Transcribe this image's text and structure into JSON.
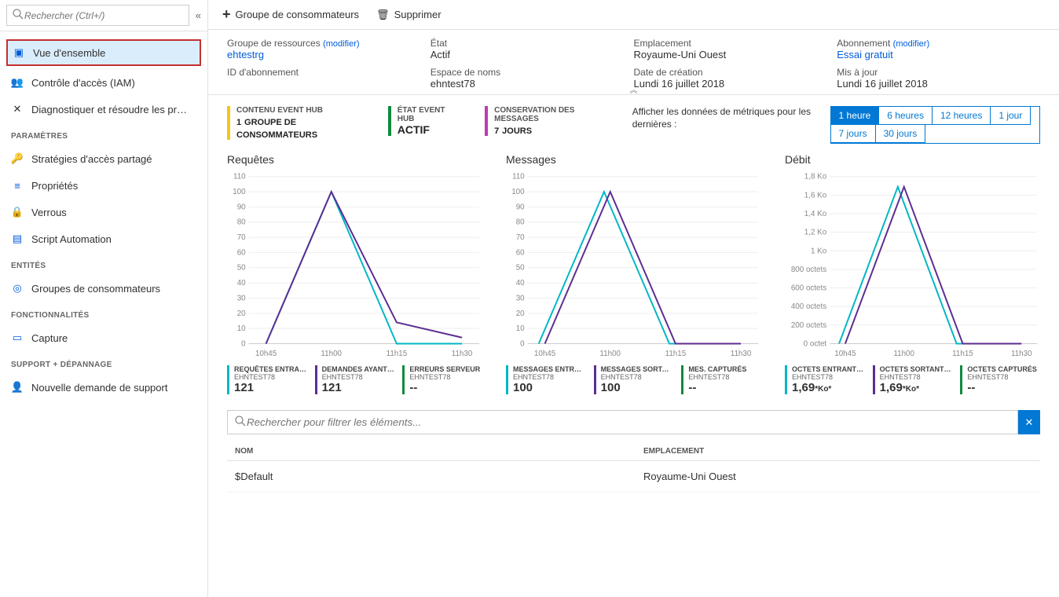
{
  "sidebar": {
    "search_placeholder": "Rechercher (Ctrl+/)",
    "items": {
      "overview": "Vue d'ensemble",
      "iam": "Contrôle d'accès (IAM)",
      "diag": "Diagnostiquer et résoudre les pr…"
    },
    "settings_header": "PARAMÈTRES",
    "settings": {
      "sap": "Stratégies d'accès partagé",
      "props": "Propriétés",
      "locks": "Verrous",
      "script": "Script Automation"
    },
    "entities_header": "ENTITÉS",
    "entities": {
      "cg": "Groupes de consommateurs"
    },
    "features_header": "FONCTIONNALITÉS",
    "features": {
      "capture": "Capture"
    },
    "support_header": "SUPPORT + DÉPANNAGE",
    "support": {
      "new": "Nouvelle demande de support"
    }
  },
  "toolbar": {
    "add": "Groupe de consommateurs",
    "delete": "Supprimer"
  },
  "ess": {
    "rg_label": "Groupe de ressources",
    "rg_value": "ehtestrg",
    "modify": "(modifier)",
    "status_label": "État",
    "status_value": "Actif",
    "loc_label": "Emplacement",
    "loc_value": "Royaume-Uni Ouest",
    "sub_label": "Abonnement",
    "sub_value": "Essai gratuit",
    "subid_label": "ID d'abonnement",
    "ns_label": "Espace de noms",
    "ns_value": "ehntest78",
    "created_label": "Date de création",
    "created_value": "Lundi 16 juillet 2018",
    "updated_label": "Mis à jour",
    "updated_value": "Lundi 16 juillet 2018"
  },
  "pills": {
    "content_t": "CONTENU EVENT HUB",
    "content_v": "1",
    "content_u": "GROUPE DE CONSOMMATEURS",
    "state_t": "ÉTAT EVENT HUB",
    "state_v": "ACTIF",
    "ret_t": "CONSERVATION DES MESSAGES",
    "ret_v": "7",
    "ret_u": "JOURS"
  },
  "time": {
    "prompt": "Afficher les données de métriques pour les dernières :",
    "opts": [
      "1 heure",
      "6 heures",
      "12 heures",
      "1 jour",
      "7 jours",
      "30 jours"
    ]
  },
  "charts": {
    "requests": {
      "title": "Requêtes",
      "stats": [
        {
          "t": "REQUÊTES ENTRANTES…",
          "s": "EHNTEST78",
          "v": "121",
          "c": "#00b7c3"
        },
        {
          "t": "DEMANDES AYANT RÉUSSI",
          "s": "EHNTEST78",
          "v": "121",
          "c": "#5c2d91"
        },
        {
          "t": "ERREURS SERVEUR",
          "s": "EHNTEST78",
          "v": "--",
          "c": "#10893e"
        }
      ]
    },
    "messages": {
      "title": "Messages",
      "stats": [
        {
          "t": "MESSAGES ENTRANTS…",
          "s": "EHNTEST78",
          "v": "100",
          "c": "#00b7c3"
        },
        {
          "t": "MESSAGES SORTANTS…",
          "s": "EHNTEST78",
          "v": "100",
          "c": "#5c2d91"
        },
        {
          "t": "MES. CAPTURÉS",
          "s": "EHNTEST78",
          "v": "--",
          "c": "#10893e"
        }
      ]
    },
    "debit": {
      "title": "Débit",
      "unit": "*Ko*",
      "stats": [
        {
          "t": "OCTETS ENTRANTS (…",
          "s": "EHNTEST78",
          "v": "1,69",
          "c": "#00b7c3"
        },
        {
          "t": "OCTETS SORTANTS (…",
          "s": "EHNTEST78",
          "v": "1,69",
          "c": "#5c2d91"
        },
        {
          "t": "OCTETS CAPTURÉS",
          "s": "EHNTEST78",
          "v": "--",
          "c": "#10893e"
        }
      ]
    }
  },
  "chart_data": [
    {
      "type": "line",
      "title": "Requêtes",
      "x": [
        "10h45",
        "11h00",
        "11h15",
        "11h30"
      ],
      "ylim": [
        0,
        110
      ],
      "yticks": [
        0,
        10,
        20,
        30,
        40,
        50,
        60,
        70,
        80,
        90,
        100,
        110
      ],
      "series": [
        {
          "name": "REQUÊTES ENTRANTES",
          "color": "#00b7c3",
          "values": [
            0,
            100,
            0,
            0
          ]
        },
        {
          "name": "DEMANDES AYANT RÉUSSI",
          "color": "#5c2d91",
          "values": [
            0,
            100,
            14,
            4
          ],
          "partial": [
            0,
            100,
            14,
            0,
            4
          ]
        }
      ]
    },
    {
      "type": "line",
      "title": "Messages",
      "x": [
        "10h45",
        "11h00",
        "11h15",
        "11h30"
      ],
      "ylim": [
        0,
        110
      ],
      "yticks": [
        0,
        10,
        20,
        30,
        40,
        50,
        60,
        70,
        80,
        90,
        100,
        110
      ],
      "series": [
        {
          "name": "MESSAGES ENTRANTS",
          "color": "#00b7c3",
          "values": [
            0,
            100,
            0,
            0
          ],
          "offset": -8
        },
        {
          "name": "MESSAGES SORTANTS",
          "color": "#5c2d91",
          "values": [
            0,
            100,
            0,
            0
          ]
        }
      ]
    },
    {
      "type": "line",
      "title": "Débit",
      "x": [
        "10h45",
        "11h00",
        "11h15",
        "11h30"
      ],
      "ylim": [
        0,
        1800
      ],
      "yticks_labels": [
        "0 octet",
        "200 octets",
        "400 octets",
        "600 octets",
        "800 octets",
        "1 Ko",
        "1,2 Ko",
        "1,4 Ko",
        "1,6 Ko",
        "1,8 Ko"
      ],
      "series": [
        {
          "name": "OCTETS ENTRANTS",
          "color": "#00b7c3",
          "values": [
            0,
            1690,
            0,
            0
          ],
          "offset": -8
        },
        {
          "name": "OCTETS SORTANTS",
          "color": "#5c2d91",
          "values": [
            0,
            1690,
            0,
            0
          ]
        }
      ]
    }
  ],
  "filter": {
    "placeholder": "Rechercher pour filtrer les éléments..."
  },
  "table": {
    "h1": "NOM",
    "h2": "EMPLACEMENT",
    "rows": [
      {
        "name": "$Default",
        "loc": "Royaume-Uni Ouest"
      }
    ]
  }
}
